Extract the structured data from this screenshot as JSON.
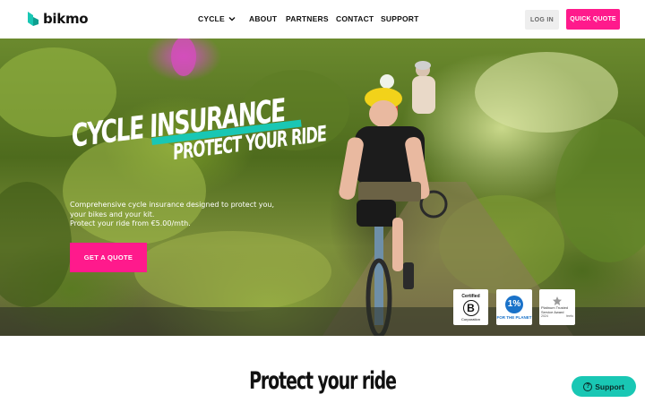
{
  "header": {
    "logo_text": "bikmo",
    "nav": [
      {
        "label": "CYCLE"
      },
      {
        "label": "ABOUT"
      },
      {
        "label": "PARTNERS"
      },
      {
        "label": "CONTACT"
      },
      {
        "label": "SUPPORT"
      }
    ],
    "login_label": "LOG IN",
    "quick_quote_label": "QUICK QUOTE"
  },
  "hero": {
    "title_line1": "CYCLE INSURANCE",
    "title_line2": "PROTECT YOUR RIDE",
    "desc_line1": "Comprehensive cycle insurance designed to protect you,",
    "desc_line2": "your bikes and your kit.",
    "desc_line3": "Protect your ride from €5.00/mth.",
    "cta_label": "GET A QUOTE"
  },
  "badges": {
    "bcorp_top": "Certified",
    "bcorp_letter": "B",
    "bcorp_bottom": "Corporation",
    "planet_num": "1%",
    "planet_text": "FOR THE PLANET",
    "feefo_text": "Platinum Trusted Service Award",
    "feefo_year": "2024",
    "feefo_brand": "feefo"
  },
  "section": {
    "title": "Protect your ride"
  },
  "support_widget": {
    "label": "Support"
  },
  "colors": {
    "accent_pink": "#ff1a8c",
    "accent_teal": "#19c7b4"
  }
}
